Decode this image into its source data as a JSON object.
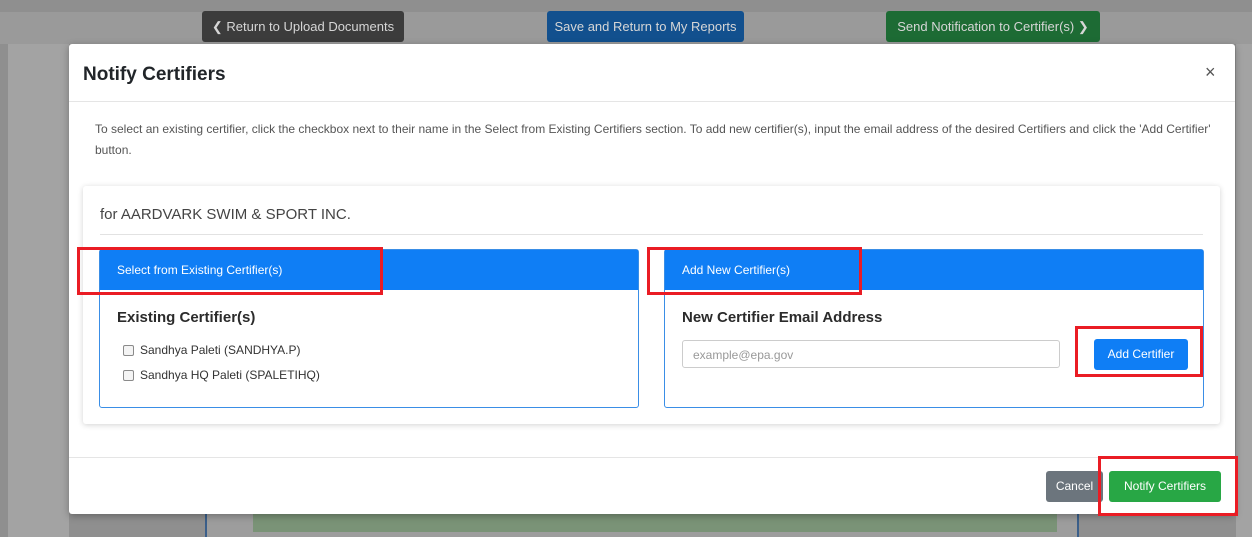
{
  "background_bar": {
    "return_button": "Return to Upload Documents",
    "save_button": "Save and Return to My Reports",
    "send_button": "Send Notification to Certifier(s)"
  },
  "modal": {
    "title": "Notify Certifiers",
    "close": "×",
    "instructions": "To select an existing certifier, click the checkbox next to their name in the Select from Existing Certifiers section. To add new certifier(s), input the email address of the desired Certifiers and click the 'Add Certifier' button.",
    "organization": "for AARDVARK SWIM & SPORT INC.",
    "existing_panel": {
      "header": "Select from Existing Certifier(s)",
      "subtitle": "Existing Certifier(s)",
      "certifiers": [
        {
          "label": "Sandhya Paleti (SANDHYA.P)",
          "checked": false
        },
        {
          "label": "Sandhya HQ Paleti (SPALETIHQ)",
          "checked": false
        }
      ]
    },
    "new_panel": {
      "header": "Add New Certifier(s)",
      "subtitle": "New Certifier Email Address",
      "email_placeholder": "example@epa.gov",
      "add_button": "Add Certifier"
    },
    "footer": {
      "cancel": "Cancel",
      "notify": "Notify Certifiers"
    }
  },
  "colors": {
    "panel_header": "#0f7ef5",
    "primary_button": "#0f7ef5",
    "success_button": "#28a745",
    "secondary_button": "#6c757d",
    "highlight": "#ea1c24"
  }
}
